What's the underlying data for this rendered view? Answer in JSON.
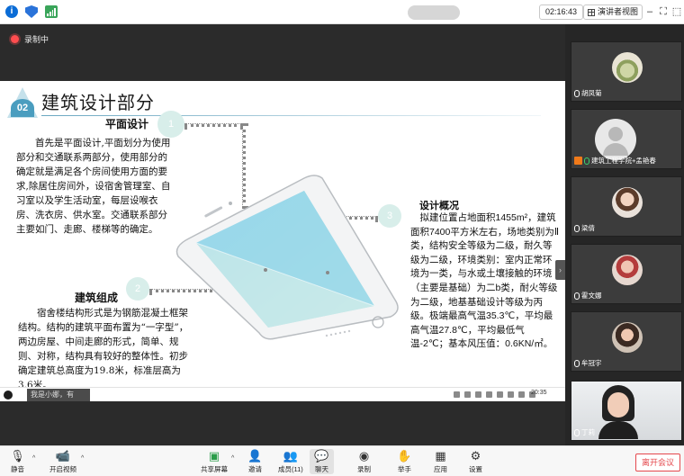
{
  "topbar": {
    "time": "02:16:43",
    "view_label": "演讲者视图"
  },
  "recording": {
    "label": "录制中"
  },
  "slide": {
    "number": "02",
    "title": "建筑设计部分",
    "plan_heading": "平面设计",
    "plan_text": "首先是平面设计,平面划分为使用部分和交通联系两部分，使用部分的确定就是满足各个房间使用方面的要求,除居住房间外，设宿舍管理室、自习室以及学生活动室，每层设喉衣房、洗衣房、供水室。交通联系部分主要如门、走廊、楼梯等的确定。",
    "comp_heading": "建筑组成",
    "comp_text": "宿舍楼结构形式是为钢筋混凝土框架结构。结构的建筑平面布置为“一字型”，两边房屋、中间走廊的形式，简单、规则、对称，结构具有较好的整体性。初步确定建筑总高度为19.8米，标准层高为3.6米。",
    "overview_heading": "设计概况",
    "overview_text": "拟建位置占地面积1455m²，建筑面积7400平方米左右，场地类别为Ⅱ类，结构安全等级为二级，耐久等级为二级，环境类别：室内正常环境为一类，与水或土壤接触的环境（主要是基础）为二b类，耐火等级为二级，地基基础设计等级为丙级。极端最高气温35.3℃，平均最高气温27.8℃，平均最低气温-2℃；基本风压值：0.6KN/㎡。",
    "circle_1": "1",
    "circle_2": "2",
    "circle_3": "3"
  },
  "taskbar": {
    "search_text": "我是小娜，有",
    "clock": "20:35"
  },
  "gallery": {
    "participants": [
      {
        "name": "胡凤菊"
      },
      {
        "name": "建筑工程学院+孟艳春"
      },
      {
        "name": "梁倩"
      },
      {
        "name": "霍文娜"
      },
      {
        "name": "牟冠宇"
      },
      {
        "name": "丁莉"
      }
    ]
  },
  "toolbar": {
    "mute": "静音",
    "video": "开启视频",
    "share": "共享屏幕",
    "invite": "邀请",
    "members": "成员(11)",
    "chat": "聊天",
    "record": "录制",
    "raise": "举手",
    "apps": "应用",
    "settings": "设置",
    "leave": "离开会议"
  }
}
